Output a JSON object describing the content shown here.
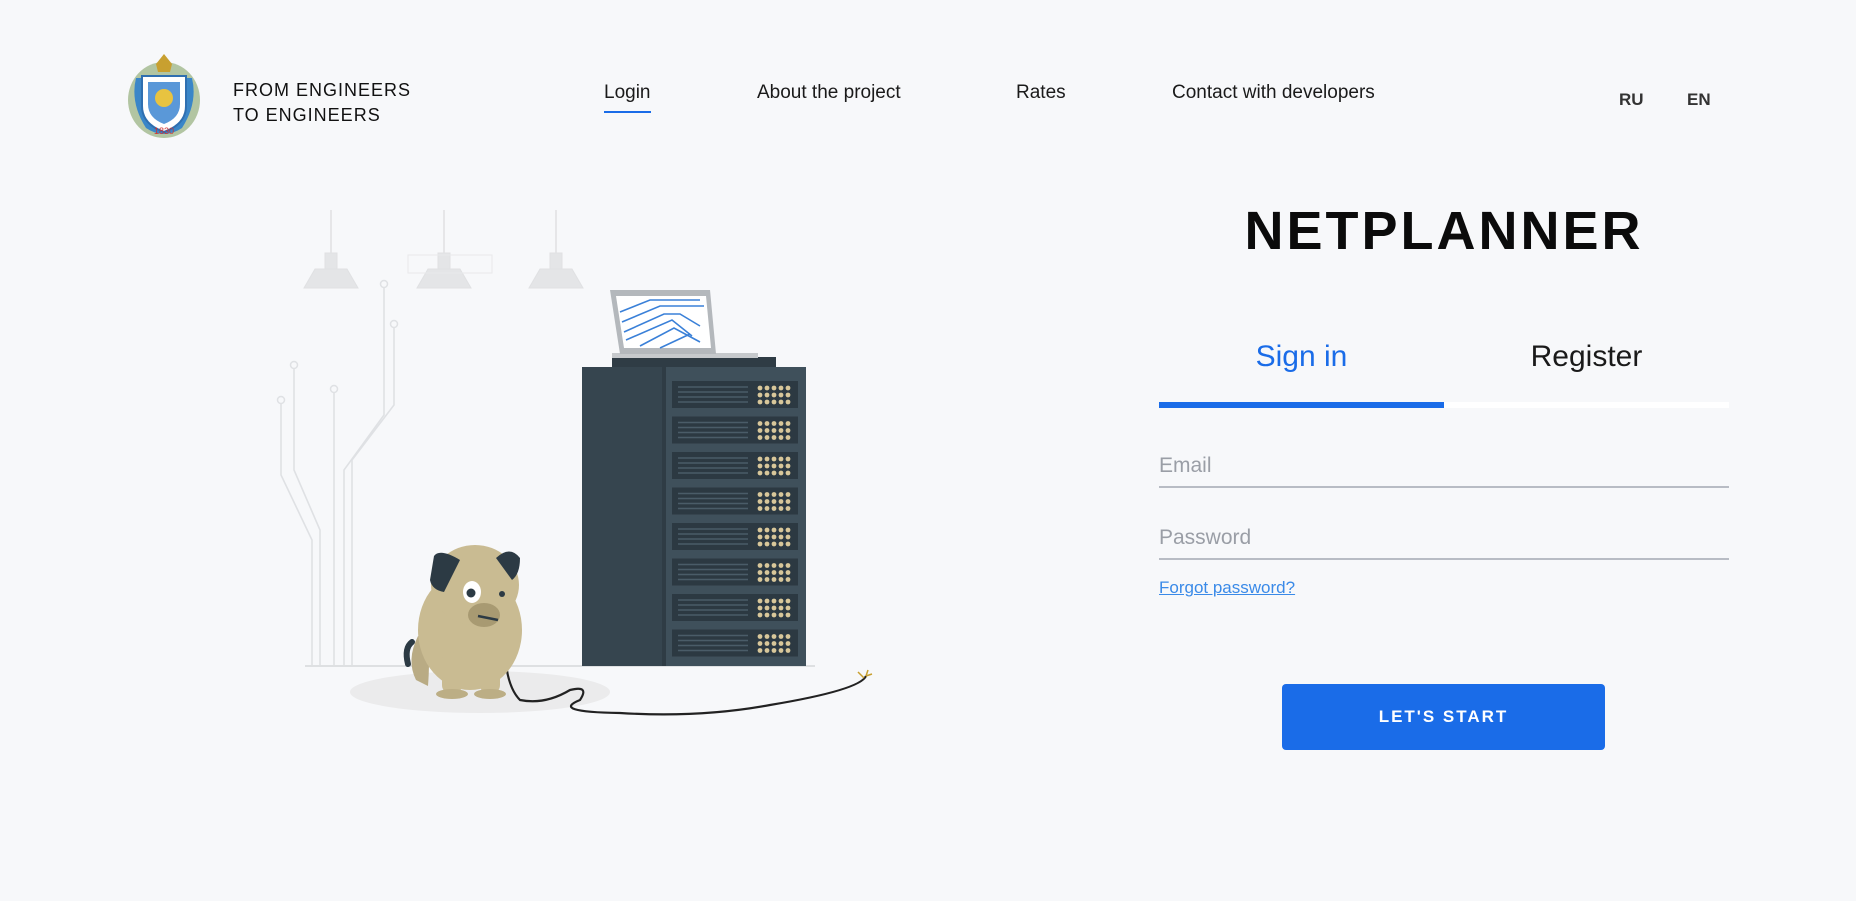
{
  "header": {
    "logo_icon": "university-crest-icon",
    "tagline_line1": "FROM ENGINEERS",
    "tagline_line2": "TO ENGINEERS",
    "nav": {
      "login": "Login",
      "about": "About the project",
      "rates": "Rates",
      "contact": "Contact with developers"
    },
    "languages": {
      "ru": "RU",
      "en": "EN"
    }
  },
  "illustration": {
    "icon": "dog-chewing-server-cable-illustration"
  },
  "auth": {
    "brand": "NETPLANNER",
    "tabs": {
      "signin": "Sign in",
      "register": "Register"
    },
    "email_placeholder": "Email",
    "password_placeholder": "Password",
    "forgot_label": "Forgot password?",
    "submit_label": "LET'S START"
  },
  "colors": {
    "accent": "#1a6ce8",
    "background": "#f7f8fa",
    "server": "#36454f"
  }
}
